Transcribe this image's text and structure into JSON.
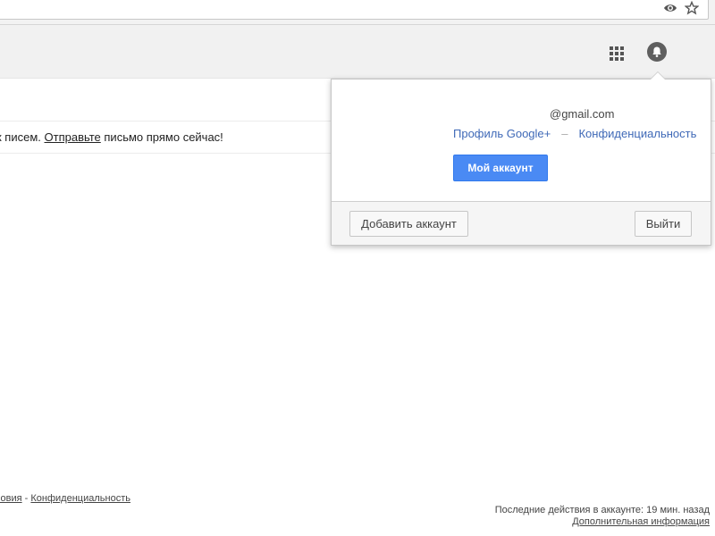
{
  "browser": {
    "icons": [
      "eye-icon",
      "star-icon"
    ]
  },
  "header": {
    "icons": [
      "apps-grid-icon",
      "avatar-icon"
    ]
  },
  "inbox": {
    "empty_text_start": "к писем. ",
    "empty_link": "Отправьте",
    "empty_text_end": " письмо прямо сейчас!"
  },
  "account_popup": {
    "email": "@gmail.com",
    "profile_link": "Профиль Google+",
    "separator": "–",
    "privacy_link": "Конфиденциальность",
    "my_account_button": "Мой аккаунт",
    "add_account_button": "Добавить аккаунт",
    "sign_out_button": "Выйти"
  },
  "footer": {
    "terms_link": "ловия",
    "dash": " - ",
    "privacy_link": "Конфиденциальность",
    "last_activity": "Последние действия в аккаунте: 19 мин. назад",
    "details_link": "Дополнительная информация"
  },
  "colors": {
    "accent_blue": "#4a8af4",
    "link_blue": "#3f69b7",
    "header_bg": "#f1f1f1"
  }
}
